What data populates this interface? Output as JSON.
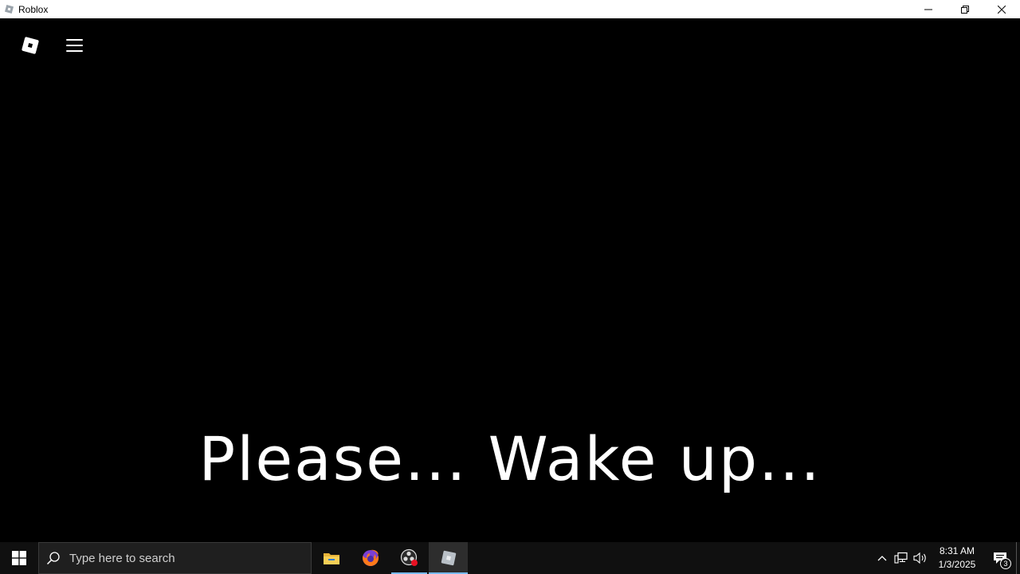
{
  "window": {
    "title": "Roblox",
    "icon": "roblox-icon"
  },
  "game": {
    "logo": "roblox-logo-icon",
    "menu": "hamburger-menu-icon",
    "subtitle": "Please... Wake up..."
  },
  "taskbar": {
    "search_placeholder": "Type here to search",
    "apps": [
      {
        "name": "file-explorer-icon"
      },
      {
        "name": "firefox-icon"
      },
      {
        "name": "obs-icon"
      },
      {
        "name": "roblox-taskbar-icon"
      }
    ],
    "clock": {
      "time": "8:31 AM",
      "date": "1/3/2025"
    },
    "notification_count": "3"
  },
  "colors": {
    "background": "#000000",
    "taskbar": "#101010",
    "accent": "#76b9ed"
  }
}
